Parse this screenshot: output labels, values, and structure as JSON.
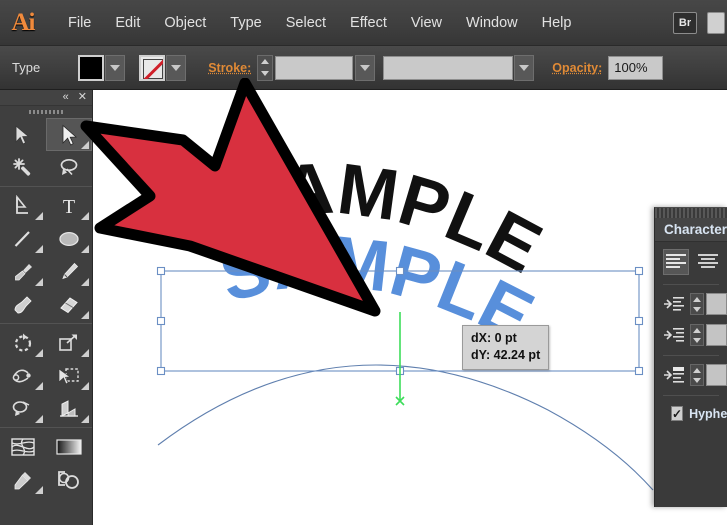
{
  "app": {
    "name": "Ai",
    "logo_text": "Ai"
  },
  "menubar": {
    "items": [
      {
        "label": "File"
      },
      {
        "label": "Edit"
      },
      {
        "label": "Object"
      },
      {
        "label": "Type"
      },
      {
        "label": "Select"
      },
      {
        "label": "Effect"
      },
      {
        "label": "View"
      },
      {
        "label": "Window"
      },
      {
        "label": "Help"
      }
    ],
    "bridge_label": "Br"
  },
  "controlbar": {
    "tool_context_label": "Type",
    "fill_swatch_color": "#000000",
    "stroke_swatch": "none",
    "stroke_label": "Stroke:",
    "stroke_weight_value": "",
    "stroke_profile_value": "",
    "opacity_label": "Opacity:",
    "opacity_value": "100%"
  },
  "toolpanel": {
    "collapse_glyph": "«",
    "close_glyph": "✕",
    "tools": [
      {
        "name": "selection-tool",
        "label": "Selection",
        "selected": false,
        "has_flyout": false
      },
      {
        "name": "direct-selection-tool",
        "label": "Direct Selection",
        "selected": true,
        "has_flyout": true
      },
      {
        "name": "magic-wand-tool",
        "label": "Magic Wand",
        "selected": false,
        "has_flyout": false
      },
      {
        "name": "lasso-tool",
        "label": "Lasso",
        "selected": false,
        "has_flyout": false
      },
      {
        "name": "pen-tool",
        "label": "Pen",
        "selected": false,
        "has_flyout": true
      },
      {
        "name": "type-tool",
        "label": "Type",
        "selected": false,
        "has_flyout": true
      },
      {
        "name": "line-segment-tool",
        "label": "Line Segment",
        "selected": false,
        "has_flyout": true
      },
      {
        "name": "ellipse-tool",
        "label": "Ellipse",
        "selected": false,
        "has_flyout": true
      },
      {
        "name": "paintbrush-tool",
        "label": "Paintbrush",
        "selected": false,
        "has_flyout": true
      },
      {
        "name": "pencil-tool",
        "label": "Pencil",
        "selected": false,
        "has_flyout": true
      },
      {
        "name": "blob-brush-tool",
        "label": "Blob Brush",
        "selected": false,
        "has_flyout": false
      },
      {
        "name": "eraser-tool",
        "label": "Eraser",
        "selected": false,
        "has_flyout": true
      },
      {
        "name": "rotate-tool",
        "label": "Rotate",
        "selected": false,
        "has_flyout": true
      },
      {
        "name": "scale-tool",
        "label": "Scale",
        "selected": false,
        "has_flyout": true
      },
      {
        "name": "width-tool",
        "label": "Width",
        "selected": false,
        "has_flyout": true
      },
      {
        "name": "free-transform-tool",
        "label": "Free Transform",
        "selected": false,
        "has_flyout": true
      },
      {
        "name": "shape-builder-tool",
        "label": "Shape Builder",
        "selected": false,
        "has_flyout": true
      },
      {
        "name": "perspective-grid-tool",
        "label": "Perspective Grid",
        "selected": false,
        "has_flyout": true
      },
      {
        "name": "mesh-tool",
        "label": "Mesh",
        "selected": false,
        "has_flyout": false
      },
      {
        "name": "gradient-tool",
        "label": "Gradient",
        "selected": false,
        "has_flyout": false
      },
      {
        "name": "eyedropper-tool",
        "label": "Eyedropper",
        "selected": false,
        "has_flyout": true
      },
      {
        "name": "blend-tool",
        "label": "Blend",
        "selected": false,
        "has_flyout": false
      }
    ]
  },
  "canvas": {
    "artwork_text_black": "SAMPLE",
    "artwork_text_ghost": "SAMPLE",
    "black_text_color": "#111111",
    "ghost_text_color": "#4a86d8",
    "selection_color": "#6b8fc4",
    "smart_guide_color": "#3ddd5a",
    "path_color": "#5f7fae",
    "arrow_fill": "#d8303f",
    "arrow_stroke": "#000000"
  },
  "smart_tooltip": {
    "dx_line": "dX: 0 pt",
    "dy_line": "dY: 42.24 pt"
  },
  "right_panel": {
    "tab_label": "Character",
    "align_buttons": [
      {
        "name": "align-left",
        "selected": true
      },
      {
        "name": "align-center",
        "selected": false
      }
    ],
    "rows": [
      {
        "name": "left-indent",
        "value": ""
      },
      {
        "name": "right-indent",
        "value": ""
      },
      {
        "name": "space-before-paragraph",
        "value": ""
      }
    ],
    "hyphenate_label": "Hyphenate",
    "hyphenate_checked": true,
    "check_glyph": "✓"
  }
}
